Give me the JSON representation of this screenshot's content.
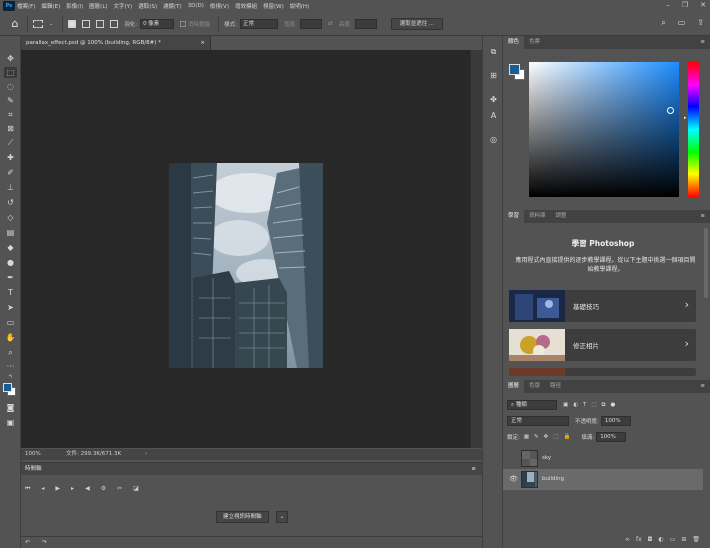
{
  "app": {
    "logo": "Ps"
  },
  "menu": [
    "檔案(F)",
    "編輯(E)",
    "影像(I)",
    "圖層(L)",
    "文字(Y)",
    "選取(S)",
    "濾鏡(T)",
    "3D(D)",
    "檢視(V)",
    "增效模組",
    "視窗(W)",
    "說明(H)"
  ],
  "options": {
    "feather_label": "羽化:",
    "feather_value": "0 像素",
    "anti_alias_label": "消除鋸齒",
    "style_label": "樣式:",
    "style_value": "正常",
    "width_label": "寬度:",
    "height_label": "高度:",
    "select_mask_button": "選取並遮住 ..."
  },
  "document": {
    "tab_title": "parallax_effect.psd @ 100% (building, RGB/8#) *",
    "zoom": "100%",
    "file_info": "文件: 299.3K/671.3K"
  },
  "timeline": {
    "title": "時間軸",
    "create_button": "建立視訊時間軸"
  },
  "color_panel": {
    "tabs": [
      "顏色",
      "色票"
    ],
    "foreground": "#155e96",
    "background": "#ffffff"
  },
  "learn_panel": {
    "tabs": [
      "學習",
      "資料庫",
      "調整"
    ],
    "title": "學習 Photoshop",
    "description": "應用程式內直接提供的逐步教學課程。從以下主題中挑選一個項目開始教學課程。",
    "cards": [
      {
        "title": "基礎技巧"
      },
      {
        "title": "修正相片"
      }
    ]
  },
  "layers_panel": {
    "tabs": [
      "圖層",
      "色版",
      "路徑"
    ],
    "kind_filter": "種類",
    "blend_mode": "正常",
    "opacity_label": "不透明度:",
    "opacity_value": "100%",
    "lock_label": "鎖定:",
    "fill_label": "填滿:",
    "fill_value": "100%",
    "layers": [
      {
        "name": "sky",
        "visible": false,
        "selected": false
      },
      {
        "name": "building",
        "visible": true,
        "selected": true
      }
    ]
  }
}
